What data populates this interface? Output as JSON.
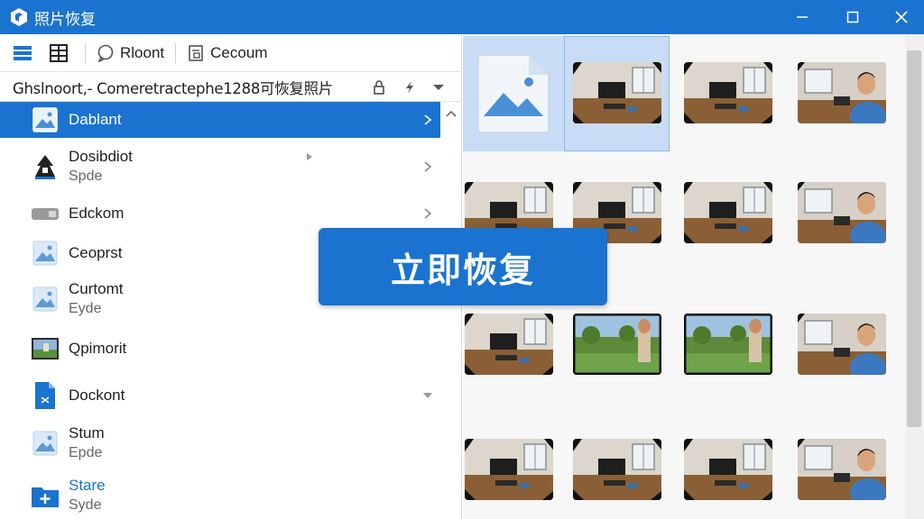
{
  "window": {
    "title": "照片恢复",
    "controls": [
      "minimize",
      "maximize",
      "close"
    ]
  },
  "colors": {
    "accent": "#1a73cf",
    "selected_cell": "#c8ddf5"
  },
  "toolbar": {
    "view_icon": "list-view-icon",
    "grid_icon": "grid-icon",
    "recent_label": "Rloont",
    "document_label": "Cecoum"
  },
  "pathbar": {
    "path": "Ghslnoort,- Comeretractephe1288可恢复照片",
    "icons": [
      "lock-icon",
      "flash-icon",
      "dropdown-icon"
    ]
  },
  "sidebar": {
    "items": [
      {
        "name": "Dablant",
        "sub": "",
        "icon": "image-file-icon",
        "selected": true
      },
      {
        "name": "Dosibdiot",
        "sub": "Spde",
        "icon": "app-icon",
        "selected": false
      },
      {
        "name": "Edckom",
        "sub": "",
        "icon": "drive-icon",
        "selected": false
      },
      {
        "name": "Ceoprst",
        "sub": "",
        "icon": "image-file-icon",
        "selected": false
      },
      {
        "name": "Curtomt",
        "sub": "Eyde",
        "icon": "image-file-icon",
        "selected": false
      },
      {
        "name": "Qpimorit",
        "sub": "",
        "icon": "photo-thumbnail-icon",
        "selected": false
      },
      {
        "name": "Dockont",
        "sub": "",
        "icon": "document-icon",
        "selected": false
      },
      {
        "name": "Stum",
        "sub": "Epde",
        "icon": "image-file-icon",
        "selected": false
      },
      {
        "name": "Stare",
        "sub": "Syde",
        "icon": "add-folder-icon",
        "selected": false
      }
    ]
  },
  "recover_button": {
    "label": "立即恢复"
  },
  "gallery": {
    "rows": [
      [
        "placeholder",
        "desk",
        "desk",
        "person"
      ],
      [
        "desk",
        "desk",
        "desk",
        "person"
      ],
      [
        "desk",
        "outdoor",
        "outdoor",
        "person"
      ],
      [
        "desk",
        "desk",
        "desk",
        "person"
      ]
    ],
    "selected": [
      0,
      1
    ]
  }
}
